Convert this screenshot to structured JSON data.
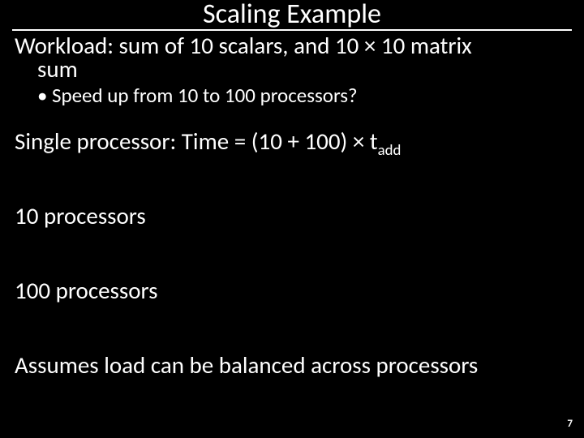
{
  "slide": {
    "title": "Scaling Example",
    "workload_line1": "Workload: sum of 10 scalars, and 10 × 10 matrix",
    "workload_line2": "sum",
    "speedup_question": "Speed up from 10 to 100 processors?",
    "single_proc_prefix": "Single processor: Time = (10 + 100) × t",
    "single_proc_sub": "add",
    "ten_proc": "10 processors",
    "hundred_proc": "100 processors",
    "assumption": "Assumes load can be balanced across processors",
    "page_number": "7"
  }
}
